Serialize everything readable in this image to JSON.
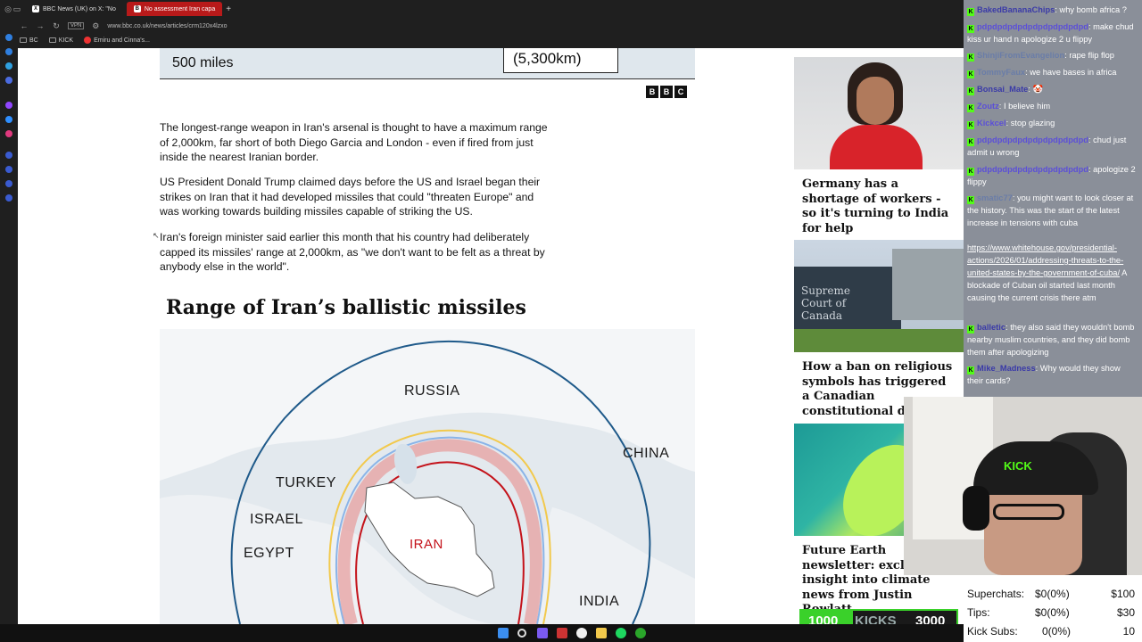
{
  "browser": {
    "tabs": [
      {
        "label": "BBC News (UK) on X: \"No",
        "favicon": "X",
        "active": false
      },
      {
        "label": "No assessment Iran capa",
        "favicon": "B",
        "active": true
      }
    ],
    "new_tab": "+",
    "url": "www.bbc.co.uk/news/articles/crm120x4lzxo",
    "vpn_badge": "VPN",
    "bookmarks": [
      "BC",
      "KICK",
      "Emiru and Cinna's..."
    ]
  },
  "article": {
    "map_top": {
      "miles": "500 miles",
      "km": "(5,300km)"
    },
    "bbc_logo": [
      "B",
      "B",
      "C"
    ],
    "paragraphs": [
      "The longest-range weapon in Iran's arsenal is thought to have a maximum range of 2,000km, far short of both Diego Garcia and London - even if fired from just inside the nearest Iranian border.",
      "US President Donald Trump claimed days before the US and Israel began their strikes on Iran that it had developed missiles that could \"threaten Europe\" and was working towards building missiles capable of striking the US.",
      "Iran's foreign minister said earlier this month that his country had deliberately capped its missiles' range at 2,000km, as \"we don't want to be felt as a threat by anybody else in the world\"."
    ],
    "map_title": "Range of Iran’s ballistic missiles",
    "map_labels": {
      "russia": "RUSSIA",
      "china": "CHINA",
      "turkey": "TURKEY",
      "israel": "ISRAEL",
      "egypt": "EGYPT",
      "iran": "IRAN",
      "india": "INDIA"
    }
  },
  "promos": [
    {
      "title": "Germany has a shortage of workers - so it's turning to India for help"
    },
    {
      "title": "How a ban on religious symbols has triggered a Canadian constitutional debate",
      "img_text": "Supreme Court of Canada"
    },
    {
      "title": "Future Earth newsletter: exclusive insight into climate news from Justin Rowlatt"
    }
  ],
  "chat": [
    {
      "user": "BakedBananaChips",
      "text": "why bomb africa ?"
    },
    {
      "user": "pdpdpdpdpdpdpdpdpdpdpd",
      "text": "make chud kiss ur hand n apologize 2 u flippy"
    },
    {
      "user": "ShinjiFromEvangelion",
      "text": "rape flip flop"
    },
    {
      "user": "TommyFaux",
      "text": "we have bases in africa"
    },
    {
      "user": "Bonsai_Mate",
      "text": "🤡"
    },
    {
      "user": "Zoutz",
      "text": "I believe him"
    },
    {
      "user": "Kickcel",
      "text": "stop glazing"
    },
    {
      "user": "pdpdpdpdpdpdpdpdpdpdpd",
      "text": "chud just admit u wrong"
    },
    {
      "user": "pdpdpdpdpdpdpdpdpdpdpd",
      "text": "apologize 2 flippy"
    },
    {
      "user": "smatic77",
      "text": "you might want to look closer at the history. This was the start of the latest increase in tensions with cuba"
    },
    {
      "user": "",
      "link": "https://www.whitehouse.gov/presidential-actions/2026/01/addressing-threats-to-the-united-states-by-the-government-of-cuba/",
      "text": " A blockade of Cuban oil started last month causing the current crisis there atm"
    },
    {
      "user": "balletic",
      "text": "they also said they wouldn't bomb nearby muslim countries, and they did bomb them after apologizing"
    },
    {
      "user": "Mike_Madness",
      "text": "Why would they show their cards?"
    }
  ],
  "stats": [
    {
      "label": "Superchats:",
      "value": "$0(0%)",
      "goal": "$100"
    },
    {
      "label": "Tips:",
      "value": "$0(0%)",
      "goal": "$30"
    },
    {
      "label": "Kick Subs:",
      "value": "0(0%)",
      "goal": "10"
    }
  ],
  "kicks_goal": {
    "current": "1000",
    "label": "KICKS",
    "target": "3000",
    "progress": 0.333
  },
  "colors": {
    "kick_green": "#53fc18",
    "bbc_red": "#b81a1a",
    "iran_red": "#c4121a"
  }
}
